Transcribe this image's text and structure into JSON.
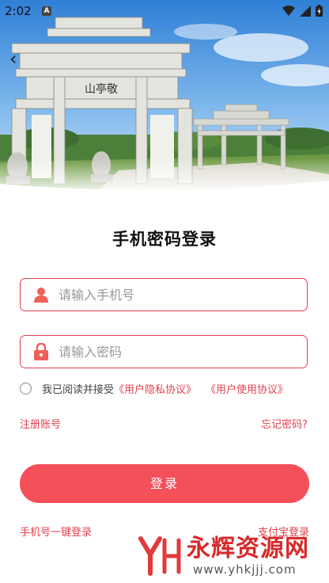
{
  "status_bar": {
    "time": "2:02",
    "notification_glyph": "A"
  },
  "hero": {
    "gate_plaque": "山亭敬",
    "icon": "gate-photo"
  },
  "page": {
    "title": "手机密码登录"
  },
  "form": {
    "phone_placeholder": "请输入手机号",
    "password_placeholder": "请输入密码",
    "agree_prefix": "我已阅读并接受",
    "privacy_link": "《用户隐私协议》",
    "terms_link": "《用户使用协议》"
  },
  "links": {
    "register": "注册账号",
    "forgot": "忘记密码?",
    "sms_login": "手机号一键登录",
    "alipay_login": "支付宝登录"
  },
  "login_button": "登录",
  "watermark": {
    "title": "永辉资源网",
    "url": "www.yhkjjj.com"
  },
  "colors": {
    "accent": "#e2404f",
    "button": "#f4505a"
  }
}
